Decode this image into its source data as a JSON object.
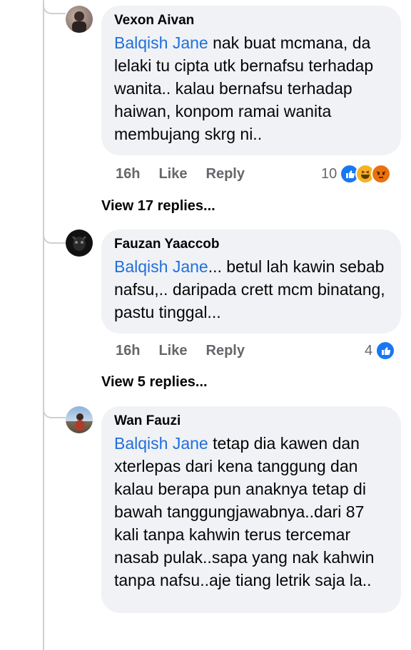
{
  "comments": [
    {
      "author": "Vexon Aivan",
      "mention": "Balqish Jane",
      "text": " nak buat mcmana, da lelaki tu cipta utk bernafsu terhadap wanita.. kalau bernafsu terhadap haiwan, konpom ramai wanita membujang skrg ni..",
      "time": "16h",
      "like_label": "Like",
      "reply_label": "Reply",
      "reaction_count": "10",
      "reactions": [
        "like-icon",
        "haha-icon",
        "angry-icon"
      ],
      "view_replies": "View 17 replies..."
    },
    {
      "author": "Fauzan Yaaccob",
      "mention": "Balqish Jane",
      "text": "... betul lah kawin sebab nafsu,.. daripada crett mcm binatang, pastu tinggal...",
      "time": "16h",
      "like_label": "Like",
      "reply_label": "Reply",
      "reaction_count": "4",
      "reactions": [
        "like-icon"
      ],
      "view_replies": "View 5 replies..."
    },
    {
      "author": "Wan Fauzi",
      "mention": "Balqish Jane",
      "text": " tetap dia kawen dan xterlepas dari kena tanggung dan kalau berapa pun anaknya tetap di bawah tanggungjawabnya..dari 87 kali tanpa kahwin terus tercemar nasab pulak..sapa yang nak kahwin tanpa nafsu..aje tiang letrik saja la.."
    }
  ],
  "colors": {
    "mention": "#216fdb",
    "bubble": "#f0f2f5",
    "like": "#1877f2",
    "haha": "#f7b125",
    "angry": "#e9710f",
    "meta": "#65676b"
  }
}
